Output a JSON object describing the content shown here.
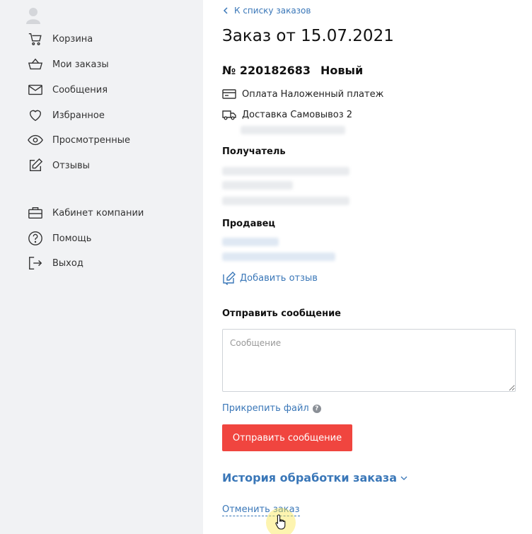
{
  "sidebar": {
    "items": [
      {
        "label": "Корзина",
        "icon": "cart-icon"
      },
      {
        "label": "Мои заказы",
        "icon": "basket-icon"
      },
      {
        "label": "Сообщения",
        "icon": "envelope-icon"
      },
      {
        "label": "Избранное",
        "icon": "heart-icon"
      },
      {
        "label": "Просмотренные",
        "icon": "eye-icon"
      },
      {
        "label": "Отзывы",
        "icon": "edit-icon"
      },
      {
        "label": "Кабинет компании",
        "icon": "briefcase-icon"
      },
      {
        "label": "Помощь",
        "icon": "question-icon"
      },
      {
        "label": "Выход",
        "icon": "logout-icon"
      }
    ]
  },
  "main": {
    "back_link": "К списку заказов",
    "title": "Заказ от 15.07.2021",
    "order_number": "№ 220182683",
    "status": "Новый",
    "payment": "Оплата Наложенный платеж",
    "delivery": "Доставка Самовывоз 2",
    "recipient_label": "Получатель",
    "seller_label": "Продавец",
    "add_review": "Добавить отзыв",
    "send_message_label": "Отправить сообщение",
    "message_placeholder": "Сообщение",
    "attach_file": "Прикрепить файл",
    "help_glyph": "?",
    "send_button": "Отправить сообщение",
    "history": "История обработки заказа",
    "cancel_order": "Отменить заказ"
  },
  "colors": {
    "accent": "#3a77b8",
    "button": "#f0453f",
    "sidebar_bg": "#f1f2f4"
  }
}
